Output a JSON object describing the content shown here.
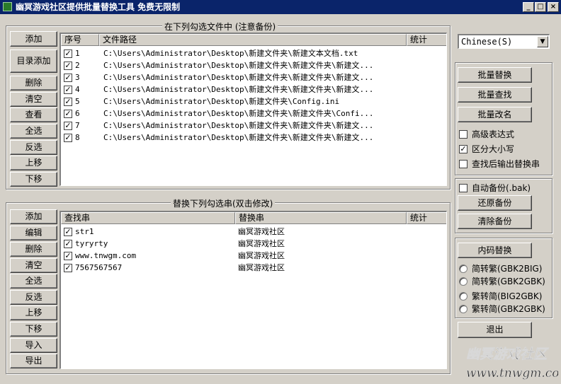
{
  "window": {
    "title": "幽冥游戏社区提供批量替换工具 免费无限制",
    "minimize": "_",
    "maximize": "□",
    "close": "×"
  },
  "file_group": {
    "label": "在下列勾选文件中 (注意备份)",
    "buttons": [
      "添加",
      "目录添加",
      "删除",
      "清空",
      "查看",
      "全选",
      "反选",
      "上移",
      "下移"
    ],
    "columns": [
      "序号",
      "文件路径",
      "统计"
    ],
    "rows": [
      {
        "checked": true,
        "num": "1",
        "path": "C:\\Users\\Administrator\\Desktop\\新建文件夹\\新建文本文档.txt",
        "count": ""
      },
      {
        "checked": true,
        "num": "2",
        "path": "C:\\Users\\Administrator\\Desktop\\新建文件夹\\新建文件夹\\新建文...",
        "count": ""
      },
      {
        "checked": true,
        "num": "3",
        "path": "C:\\Users\\Administrator\\Desktop\\新建文件夹\\新建文件夹\\新建文...",
        "count": ""
      },
      {
        "checked": true,
        "num": "4",
        "path": "C:\\Users\\Administrator\\Desktop\\新建文件夹\\新建文件夹\\新建文...",
        "count": ""
      },
      {
        "checked": true,
        "num": "5",
        "path": "C:\\Users\\Administrator\\Desktop\\新建文件夹\\Config.ini",
        "count": ""
      },
      {
        "checked": true,
        "num": "6",
        "path": "C:\\Users\\Administrator\\Desktop\\新建文件夹\\新建文件夹\\Confi...",
        "count": ""
      },
      {
        "checked": true,
        "num": "7",
        "path": "C:\\Users\\Administrator\\Desktop\\新建文件夹\\新建文件夹\\新建文...",
        "count": ""
      },
      {
        "checked": true,
        "num": "8",
        "path": "C:\\Users\\Administrator\\Desktop\\新建文件夹\\新建文件夹\\新建文...",
        "count": ""
      }
    ]
  },
  "replace_group": {
    "label": "替换下列勾选串(双击修改)",
    "buttons": [
      "添加",
      "编辑",
      "删除",
      "清空",
      "全选",
      "反选",
      "上移",
      "下移",
      "导入",
      "导出"
    ],
    "columns": [
      "查找串",
      "替换串",
      "统计"
    ],
    "rows": [
      {
        "checked": true,
        "find": "str1",
        "replace": "幽冥游戏社区",
        "count": ""
      },
      {
        "checked": true,
        "find": "tyryrty",
        "replace": "幽冥游戏社区",
        "count": ""
      },
      {
        "checked": true,
        "find": "www.tnwgm.com",
        "replace": "幽冥游戏社区",
        "count": ""
      },
      {
        "checked": true,
        "find": "7567567567",
        "replace": "幽冥游戏社区",
        "count": ""
      }
    ]
  },
  "encoding_select": {
    "value": "Chinese(S)"
  },
  "actions": {
    "buttons": [
      "批量替换",
      "批量查找",
      "批量改名"
    ],
    "options": [
      {
        "label": "高级表达式",
        "checked": false
      },
      {
        "label": "区分大小写",
        "checked": true
      },
      {
        "label": "查找后输出替换串",
        "checked": false
      }
    ]
  },
  "backup": {
    "auto_label": "自动备份(.bak)",
    "auto_checked": false,
    "buttons": [
      "还原备份",
      "清除备份"
    ]
  },
  "internal_code": {
    "button": "内码替换",
    "options": [
      "简转繁(GBK2BIG)",
      "简转繁(GBK2GBK)",
      "繁转简(BIG2GBK)",
      "繁转简(GBK2GBK)"
    ]
  },
  "exit_label": "退出",
  "watermark": {
    "line1": "幽冥游戏社区",
    "line2": "www.tnwgm.com"
  },
  "check_mark": "✓",
  "icons": {
    "dropdown": "chevron-down-icon"
  }
}
